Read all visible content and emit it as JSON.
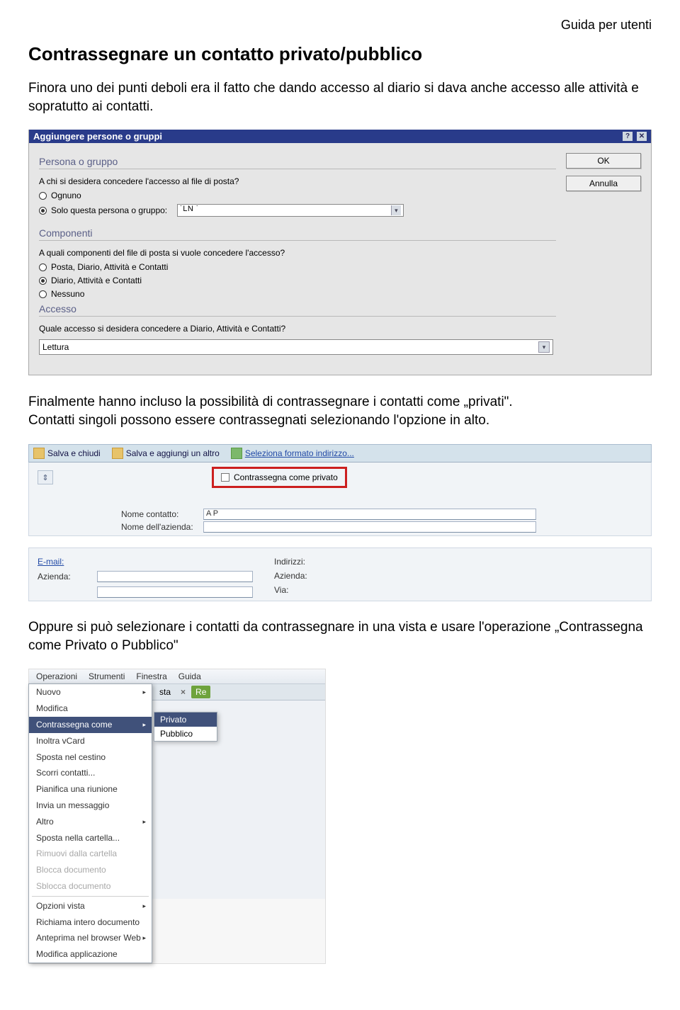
{
  "header": {
    "guide": "Guida per utenti"
  },
  "title": "Contrassegnare un contatto privato/pubblico",
  "para1": "Finora uno dei punti deboli era il fatto che dando accesso al diario si dava anche accesso alle attività e sopratutto ai contatti.",
  "para2_a": "Finalmente hanno incluso la possibilità di contrassegnare i contatti come „privati\".",
  "para2_b": "Contatti singoli possono essere contrassegnati selezionando l'opzione in alto.",
  "para3": "Oppure si può selezionare i contatti da contrassegnare in una vista e usare l'operazione „Contrassegna come Privato o Pubblico\"",
  "dialog1": {
    "title": "Aggiungere persone o gruppi",
    "buttons": {
      "ok": "OK",
      "cancel": "Annulla"
    },
    "persona": {
      "heading": "Persona o gruppo",
      "question": "A chi si desidera concedere l'accesso al file di posta?",
      "opt_everyone": "Ognuno",
      "opt_only": "Solo questa persona o gruppo:",
      "value": "˙LN ˙"
    },
    "componenti": {
      "heading": "Componenti",
      "question": "A quali componenti del file di posta si vuole concedere l'accesso?",
      "opt1": "Posta, Diario, Attività e Contatti",
      "opt2": "Diario, Attività e Contatti",
      "opt3": "Nessuno"
    },
    "accesso": {
      "heading": "Accesso",
      "question": "Quale accesso si desidera concedere a Diario, Attività e Contatti?",
      "value": "Lettura"
    }
  },
  "toolbar2": {
    "save_close": "Salva e chiudi",
    "save_add": "Salva e aggiungi un altro",
    "format": "Seleziona formato indirizzo...",
    "privato": "Contrassegna come privato",
    "nome_contatto_label": "Nome contatto:",
    "nome_contatto_value": "A P",
    "nome_azienda_label": "Nome dell'azienda:"
  },
  "form3": {
    "email": "E-mail:",
    "azienda": "Azienda:",
    "indirizzi": "Indirizzi:",
    "via": "Via:"
  },
  "menus": {
    "bar": [
      "Operazioni",
      "Strumenti",
      "Finestra",
      "Guida"
    ],
    "tabs": {
      "sta": "sta",
      "x": "×",
      "re": "Re"
    },
    "ctx": {
      "nuovo": "Nuovo",
      "modifica": "Modifica",
      "contrassegna": "Contrassegna come",
      "inoltra": "Inoltra vCard",
      "sposta_cestino": "Sposta nel cestino",
      "scorri": "Scorri contatti...",
      "pianifica": "Pianifica una riunione",
      "invia": "Invia un messaggio",
      "altro": "Altro",
      "sposta_cartella": "Sposta nella cartella...",
      "rimuovi": "Rimuovi dalla cartella",
      "blocca": "Blocca documento",
      "sblocca": "Sblocca documento",
      "opzioni": "Opzioni vista",
      "richiama": "Richiama intero documento",
      "anteprima": "Anteprima nel browser Web",
      "modifica_app": "Modifica applicazione"
    },
    "sub": {
      "privato": "Privato",
      "pubblico": "Pubblico"
    }
  }
}
